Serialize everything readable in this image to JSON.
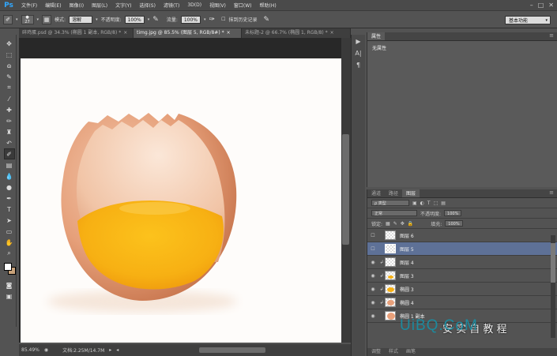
{
  "menubar": {
    "logo": "Ps",
    "items": [
      "文件(F)",
      "编辑(E)",
      "图像(I)",
      "图层(L)",
      "文字(Y)",
      "选择(S)",
      "滤镜(T)",
      "3D(D)",
      "视图(V)",
      "窗口(W)",
      "帮助(H)"
    ],
    "window_controls": [
      "–",
      "□",
      "✕"
    ]
  },
  "options": {
    "brush_size": "27",
    "mode_label": "模式:",
    "mode_value": "溶解",
    "opacity_label": "不透明度:",
    "opacity_value": "100%",
    "flow_label": "流量:",
    "flow_value": "100%",
    "history_label": "抹到历史记录",
    "workspace": "基本功能"
  },
  "tabs": [
    {
      "label": "碎鸡蛋.psd @ 34.3% (椭圆 1 副本, RGB/8) *",
      "active": false
    },
    {
      "label": "timg.jpg @ 85.5% (图层 5, RGB/8#) *",
      "active": true
    },
    {
      "label": "未标题-2 @ 66.7% (椭圆 1, RGB/8) *",
      "active": false
    }
  ],
  "status": {
    "zoom": "85.49%",
    "doc": "文档:2.25M/14.7M"
  },
  "properties": {
    "tab": "属性",
    "body": "无属性"
  },
  "layers_panel": {
    "tabs": [
      "通道",
      "路径",
      "图层"
    ],
    "filter": "ρ 类型",
    "blend_mode": "正常",
    "opacity_label": "不透明度:",
    "opacity_value": "100%",
    "lock_label": "锁定:",
    "fill_label": "填充:",
    "fill_value": "100%",
    "rows": [
      {
        "name": "图层 6",
        "selected": false,
        "visible": false,
        "clipped": false
      },
      {
        "name": "图层 5",
        "selected": true,
        "visible": false,
        "clipped": false
      },
      {
        "name": "图层 4",
        "selected": false,
        "visible": true,
        "clipped": true
      },
      {
        "name": "图层 3",
        "selected": false,
        "visible": true,
        "clipped": true
      },
      {
        "name": "椭圆 3",
        "selected": false,
        "visible": true,
        "clipped": true
      },
      {
        "name": "椭圆 4",
        "selected": false,
        "visible": true,
        "clipped": true
      },
      {
        "name": "椭圆 1 副本",
        "selected": false,
        "visible": true,
        "clipped": false
      }
    ],
    "bottom_tabs": [
      "调整",
      "样式",
      "画笔"
    ]
  },
  "watermark": {
    "text": "UiBQ.CoM",
    "cn": "安 实 自 教 程"
  },
  "colors": {
    "selected_layer": "#5e7197",
    "yolk": "#f7b013",
    "shell": "#e8a07a",
    "watermark": "#1c8a9e"
  }
}
